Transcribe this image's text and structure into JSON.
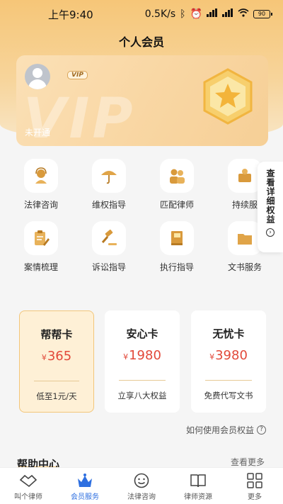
{
  "status_bar": {
    "time": "上午9:40",
    "network_speed": "0.5K/s",
    "battery": "90"
  },
  "header": {
    "title": "个人会员"
  },
  "vip_card": {
    "badge": "VIP",
    "watermark": "VIP",
    "status": "未开通"
  },
  "services": [
    {
      "label": "法律咨询",
      "icon": "lawyer-headset-icon"
    },
    {
      "label": "维权指导",
      "icon": "umbrella-icon"
    },
    {
      "label": "匹配律师",
      "icon": "people-icon"
    },
    {
      "label": "持续服",
      "icon": "service-icon"
    },
    {
      "label": "案情梳理",
      "icon": "clipboard-pen-icon"
    },
    {
      "label": "诉讼指导",
      "icon": "gavel-icon"
    },
    {
      "label": "执行指导",
      "icon": "book-icon"
    },
    {
      "label": "文书服务",
      "icon": "folder-icon"
    }
  ],
  "side_tab": {
    "label": "查看详细权益"
  },
  "membership_cards": [
    {
      "name": "帮帮卡",
      "currency": "¥",
      "price": "365",
      "desc": "低至1元/天"
    },
    {
      "name": "安心卡",
      "currency": "¥",
      "price": "1980",
      "desc": "立享八大权益"
    },
    {
      "name": "无忧卡",
      "currency": "¥",
      "price": "3980",
      "desc": "免费代写文书"
    }
  ],
  "how_to_use": "如何使用会员权益",
  "help_center": {
    "title": "帮助中心",
    "more": "查看更多"
  },
  "tabbar": [
    {
      "label": "叫个律师",
      "icon": "handshake-icon"
    },
    {
      "label": "会员服务",
      "icon": "crown-icon"
    },
    {
      "label": "法律咨询",
      "icon": "smile-icon"
    },
    {
      "label": "律师资源",
      "icon": "open-book-icon"
    },
    {
      "label": "更多",
      "icon": "grid-icon"
    }
  ],
  "colors": {
    "accent_gold": "#f5c26e",
    "price_red": "#e2493a",
    "active_tab": "#2e6fe0"
  }
}
